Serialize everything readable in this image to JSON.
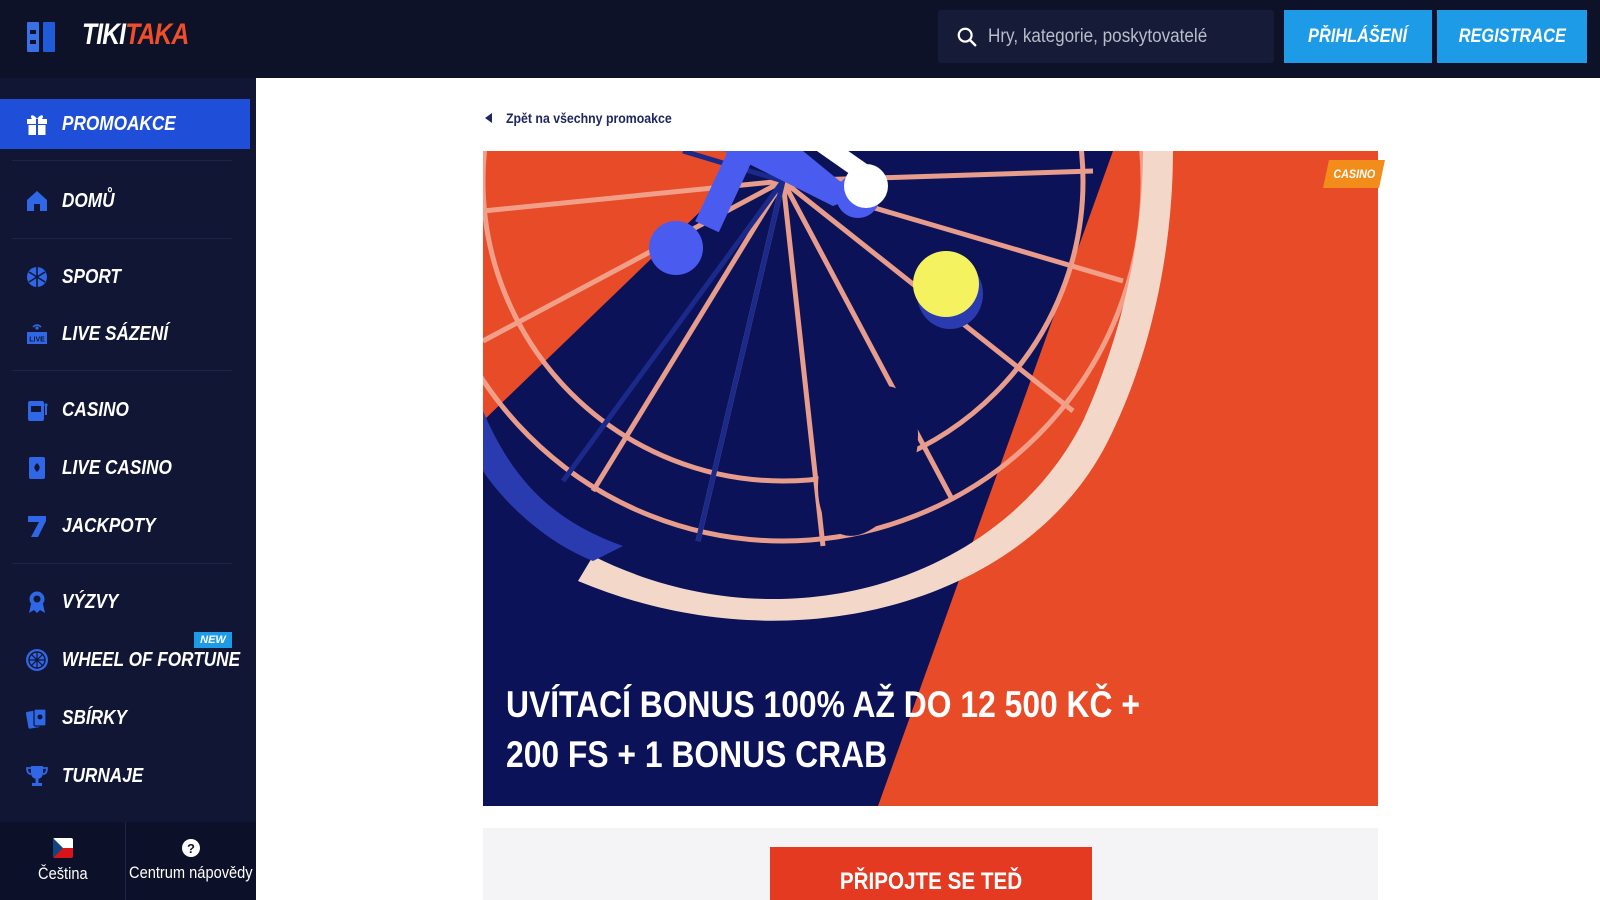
{
  "header": {
    "logo_part1": "TIKI",
    "logo_part2": "TAKA",
    "search_placeholder": "Hry, kategorie, poskytovatelé",
    "login_label": "PŘIHLÁŠENÍ",
    "register_label": "REGISTRACE"
  },
  "sidebar": {
    "items": [
      {
        "label": "PROMOAKCE",
        "icon": "gift-icon",
        "active": true
      },
      {
        "label": "DOMŮ",
        "icon": "home-icon"
      },
      {
        "label": "SPORT",
        "icon": "ball-icon"
      },
      {
        "label": "LIVE SÁZENÍ",
        "icon": "live-icon"
      },
      {
        "label": "CASINO",
        "icon": "slot-machine-icon"
      },
      {
        "label": "LIVE CASINO",
        "icon": "card-icon"
      },
      {
        "label": "JACKPOTY",
        "icon": "seven-icon"
      },
      {
        "label": "VÝZVY",
        "icon": "badge-icon"
      },
      {
        "label": "WHEEL OF FORTUNE",
        "icon": "wheel-icon"
      },
      {
        "label": "SBÍRKY",
        "icon": "cards-icon"
      },
      {
        "label": "TURNAJE",
        "icon": "trophy-icon"
      }
    ],
    "new_badge": "NEW",
    "footer": {
      "language_label": "Čeština",
      "help_label": "Centrum nápovědy",
      "help_glyph": "?"
    }
  },
  "main": {
    "back_link": "Zpět na všechny promoakce",
    "banner": {
      "tag": "CASINO",
      "title": "UVÍTACÍ BONUS 100% AŽ DO 12 500 KČ + 200 FS + 1 BONUS CRAB"
    },
    "cta_label": "PŘIPOJTE SE TEĎ"
  },
  "colors": {
    "topbar_bg": "#0e1229",
    "sidebar_bg": "#111634",
    "active_item": "#1f4fd8",
    "button_blue": "#1d9be6",
    "banner_orange": "#e84b28",
    "banner_navy": "#0c1258",
    "cta_red": "#e43a21"
  }
}
